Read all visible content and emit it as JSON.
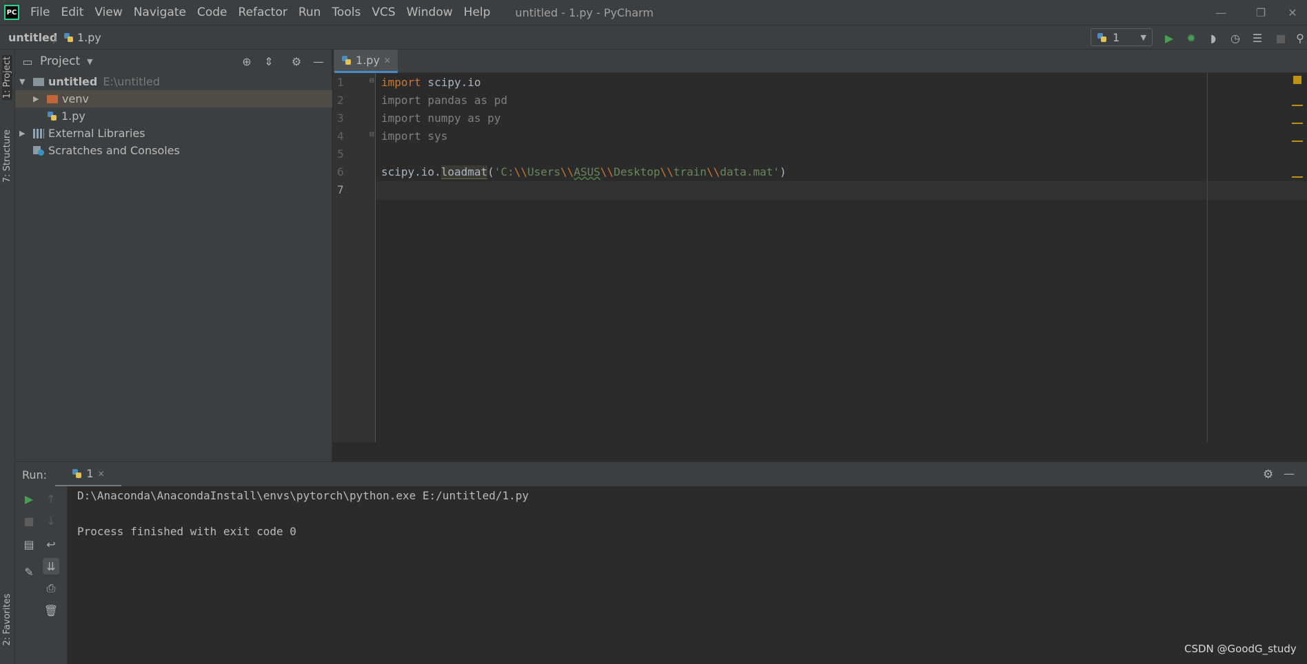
{
  "window": {
    "title": "untitled - 1.py - PyCharm",
    "logo": "PC"
  },
  "menu": [
    {
      "label": "File"
    },
    {
      "label": "Edit"
    },
    {
      "label": "View"
    },
    {
      "label": "Navigate"
    },
    {
      "label": "Code"
    },
    {
      "label": "Refactor"
    },
    {
      "label": "Run"
    },
    {
      "label": "Tools"
    },
    {
      "label": "VCS"
    },
    {
      "label": "Window"
    },
    {
      "label": "Help"
    }
  ],
  "window_controls": {
    "minimize": "—",
    "restore": "❐",
    "close": "✕"
  },
  "breadcrumb": {
    "project": "untitled",
    "separator": "〉",
    "file": "1.py"
  },
  "toolbar": {
    "run_config": "1",
    "icons": [
      "run-icon",
      "debug-icon",
      "coverage-icon",
      "profile-icon",
      "concurrency-icon",
      "stop-icon",
      "search-icon"
    ]
  },
  "left_stripe": {
    "project_tab": "1: Project",
    "structure_tab": "7: Structure",
    "favorites_tab": "2: Favorites"
  },
  "project_panel": {
    "title": "Project",
    "tree": [
      {
        "label": "untitled",
        "path": "E:\\untitled",
        "expanded": true
      },
      {
        "label": "venv",
        "expanded": false,
        "selected": true
      },
      {
        "label": "1.py"
      },
      {
        "label": "External Libraries",
        "expanded": false
      },
      {
        "label": "Scratches and Consoles"
      }
    ]
  },
  "editor": {
    "tab": "1.py",
    "line_numbers": [
      "1",
      "2",
      "3",
      "4",
      "5",
      "6",
      "7"
    ],
    "lines": {
      "l1_kw": "import",
      "l1_rest": " scipy.io",
      "l2": "import pandas as pd",
      "l3": "import numpy as py",
      "l4": "import sys",
      "l6_a": "scipy.io.",
      "l6_fn": "loadmat",
      "l6_open": "(",
      "l6_s1": "'C:",
      "l6_e1": "\\\\",
      "l6_s2": "Users",
      "l6_e2": "\\\\",
      "l6_s3": "ASUS",
      "l6_e3": "\\\\",
      "l6_s4": "Desktop",
      "l6_e4": "\\\\",
      "l6_s5": "train",
      "l6_e5": "\\\\",
      "l6_s6": "data.mat'",
      "l6_close": ")"
    }
  },
  "run_panel": {
    "label": "Run:",
    "tab": "1",
    "console": [
      "D:\\Anaconda\\AnacondaInstall\\envs\\pytorch\\python.exe E:/untitled/1.py",
      "",
      "Process finished with exit code 0"
    ]
  },
  "watermark": "CSDN @GoodG_study",
  "colors": {
    "accent": "#4a88c7",
    "keyword": "#cc7832",
    "string": "#6a8759",
    "run_green": "#499c54",
    "warning": "#be9117"
  }
}
